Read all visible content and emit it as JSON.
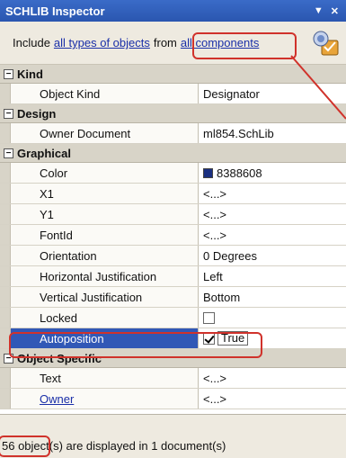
{
  "window": {
    "title": "SCHLIB Inspector",
    "controls": {
      "menu": "▼",
      "close": "✕"
    }
  },
  "filter": {
    "prefix": "Include",
    "types_link": "all types of objects",
    "middle": "from",
    "components_link": "all components"
  },
  "sections": [
    {
      "label": "Kind",
      "toggle": "⊟"
    },
    {
      "label": "Design",
      "toggle": "⊟"
    },
    {
      "label": "Graphical",
      "toggle": "⊟"
    },
    {
      "label": "Object Specific",
      "toggle": "⊟"
    }
  ],
  "kind": {
    "object_kind": {
      "name": "Object Kind",
      "value": "Designator"
    }
  },
  "design": {
    "owner_document": {
      "name": "Owner Document",
      "value": "ml854.SchLib"
    }
  },
  "graphical": {
    "color": {
      "name": "Color",
      "value": "8388608",
      "swatch": "#1a2f80"
    },
    "x1": {
      "name": "X1",
      "value": "<...>"
    },
    "y1": {
      "name": "Y1",
      "value": "<...>"
    },
    "fontid": {
      "name": "FontId",
      "value": "<...>"
    },
    "orientation": {
      "name": "Orientation",
      "value": "0 Degrees"
    },
    "hjust": {
      "name": "Horizontal Justification",
      "value": "Left"
    },
    "vjust": {
      "name": "Vertical Justification",
      "value": "Bottom"
    },
    "locked": {
      "name": "Locked",
      "checked": false
    },
    "autoposition": {
      "name": "Autoposition",
      "checked": true,
      "value": "True"
    }
  },
  "object_specific": {
    "text": {
      "name": "Text",
      "value": "<...>"
    },
    "owner": {
      "name": "Owner",
      "value": "<...>"
    }
  },
  "status": {
    "text": "56 object(s) are displayed in 1 document(s)"
  },
  "colors": {
    "title_bar": "#2f5fbf",
    "selected_row": "#3158b6",
    "highlight": "#d0322b"
  }
}
